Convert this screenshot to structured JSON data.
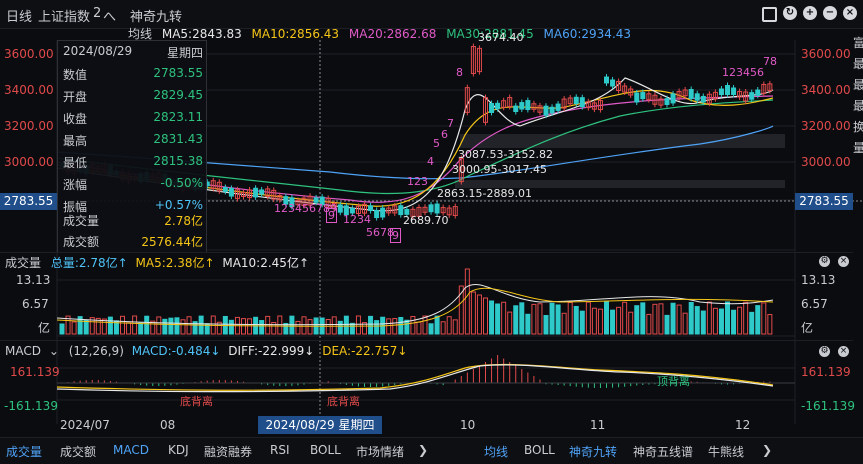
{
  "header": {
    "daily": "日线",
    "index_name": "上证指数",
    "count": "2",
    "collapse": "へ",
    "indicator": "神奇九转",
    "icons": [
      "lock-icon",
      "refresh-icon",
      "add-icon",
      "minus-icon",
      "close-icon"
    ]
  },
  "ma_bar": {
    "label": "均线",
    "ma5": "MA5:2843.83",
    "ma10": "MA10:2856.43",
    "ma20": "MA20:2862.68",
    "ma30": "MA30:2881.45",
    "ma60": "MA60:2934.43",
    "arrow": "↓"
  },
  "price_axis": {
    "labels": [
      "3600.00",
      "3400.00",
      "3200.00",
      "3000.00"
    ],
    "current": "2783.55"
  },
  "annotations": {
    "high": "3674.40",
    "low": "2689.70",
    "range1": "3087.53-3152.82",
    "range2": "3000.95-3017.45",
    "range3": "2863.15-2889.01",
    "seq_down": "123456789",
    "seq_down2": "1234",
    "seq_down3": "5678",
    "seq_nine": "9",
    "seq_up": "123",
    "seq_up_r": "123456",
    "seq_up_r2": "78",
    "n4": "4",
    "n5": "5",
    "n6": "6",
    "n7": "7",
    "n8": "8"
  },
  "tooltip": {
    "date": "2024/08/29",
    "weekday": "星期四",
    "rows": [
      {
        "k": "数值",
        "v": "2783.55"
      },
      {
        "k": "开盘",
        "v": "2829.45"
      },
      {
        "k": "收盘",
        "v": "2823.11"
      },
      {
        "k": "最高",
        "v": "2831.43"
      },
      {
        "k": "最低",
        "v": "2815.38"
      },
      {
        "k": "涨幅",
        "v": "-0.50%"
      },
      {
        "k": "振幅",
        "v": "+0.57%"
      },
      {
        "k": "成交量",
        "v": "2.78亿"
      },
      {
        "k": "成交额",
        "v": "2576.44亿"
      }
    ]
  },
  "volume": {
    "title": "成交量",
    "total": "总量:2.78亿↑",
    "ma5": "MA5:2.38亿↑",
    "ma10": "MA10:2.45亿↑",
    "axis": [
      "13.13",
      "6.57",
      "亿"
    ]
  },
  "macd": {
    "title": "MACD",
    "params": "(12,26,9)",
    "macd": "MACD:-0.484↓",
    "diff": "DIFF:-22.999↓",
    "dea": "DEA:-22.757↓",
    "axis_top": "161.139",
    "axis_bottom": "-161.139",
    "bottom_div1": "底背离",
    "bottom_div2": "底背离",
    "top_div": "顶背离"
  },
  "date_axis": {
    "labels": [
      "2024/07",
      "08",
      "10",
      "11",
      "12"
    ],
    "cursor": "2024/08/29 星期四"
  },
  "right_panel": [
    "富",
    "最",
    "最",
    "最",
    "换",
    "量"
  ],
  "tabs_left": [
    "成交量",
    "成交额",
    "MACD",
    "KDJ",
    "融资融券",
    "RSI",
    "BOLL",
    "市场情绪"
  ],
  "tabs_right": [
    "均线",
    "BOLL",
    "神奇九转",
    "神奇五线谱",
    "牛熊线"
  ],
  "tabs_more": "❯"
}
